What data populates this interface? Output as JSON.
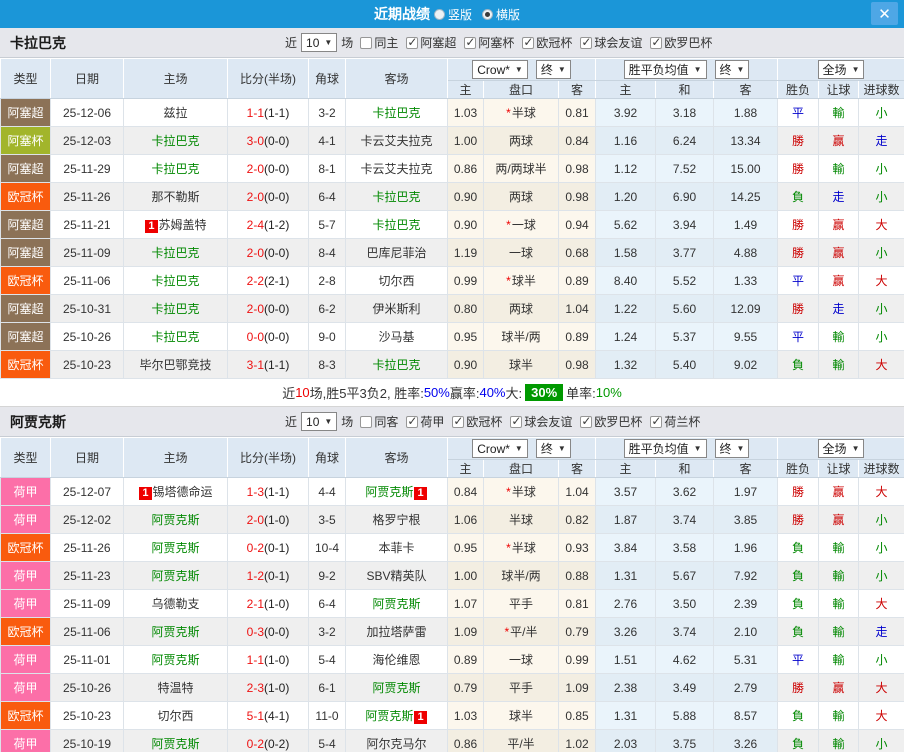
{
  "titlebar": {
    "title": "近期战绩",
    "radio_vertical": "竖版",
    "radio_horizontal": "横版",
    "close": "✕"
  },
  "columns": {
    "type": "类型",
    "date": "日期",
    "home": "主场",
    "score": "比分(半场)",
    "corner": "角球",
    "away": "客场",
    "group1_select": "Crow*",
    "group1_final": "终",
    "group2_select": "胜平负均值",
    "group2_final": "终",
    "group3_select": "全场",
    "sub": [
      "主",
      "盘口",
      "客",
      "主",
      "和",
      "客",
      "胜负",
      "让球",
      "进球数"
    ]
  },
  "type_colors": {
    "阿塞超": "#8c7257",
    "阿塞杯": "#a2b52b",
    "欧冠杯": "#f95b0e",
    "荷甲": "#fc6fa8"
  },
  "accent_colors": {
    "titlebar": "#1b96d8",
    "win": "#cc0000",
    "lose": "#008800",
    "draw": "#0000cc",
    "badge": "#ee0000"
  },
  "sections": [
    {
      "team": "卡拉巴克",
      "controls": {
        "near": "近",
        "count": "10",
        "games": "场",
        "same_label": "同主",
        "same_checked": false,
        "leagues": [
          "阿塞超",
          "阿塞杯",
          "欧冠杯",
          "球会友谊",
          "欧罗巴杯"
        ]
      },
      "rows": [
        {
          "t": "阿塞超",
          "d": "25-12-06",
          "h": "兹拉",
          "hg": 0,
          "hb": 0,
          "ft": "1-1",
          "ht": "(1-1)",
          "c": "3-2",
          "a": "卡拉巴克",
          "ag": 1,
          "ab": 0,
          "o1": "1.03",
          "st": 1,
          "hc": "半球",
          "o2": "0.81",
          "e1": "3.92",
          "e2": "3.18",
          "e3": "1.88",
          "r1": "平",
          "k1": "blue",
          "r2": "輸",
          "k2": "green",
          "r3": "小",
          "k3": "green"
        },
        {
          "t": "阿塞杯",
          "d": "25-12-03",
          "h": "卡拉巴克",
          "hg": 1,
          "hb": 0,
          "ft": "3-0",
          "ht": "(0-0)",
          "c": "4-1",
          "a": "卡云艾夫拉克",
          "ag": 0,
          "ab": 0,
          "o1": "1.00",
          "st": 0,
          "hc": "两球",
          "o2": "0.84",
          "e1": "1.16",
          "e2": "6.24",
          "e3": "13.34",
          "r1": "勝",
          "k1": "red",
          "r2": "赢",
          "k2": "red",
          "r3": "走",
          "k3": "blue"
        },
        {
          "t": "阿塞超",
          "d": "25-11-29",
          "h": "卡拉巴克",
          "hg": 1,
          "hb": 0,
          "ft": "2-0",
          "ht": "(0-0)",
          "c": "8-1",
          "a": "卡云艾夫拉克",
          "ag": 0,
          "ab": 0,
          "o1": "0.86",
          "st": 0,
          "hc": "两/两球半",
          "o2": "0.98",
          "e1": "1.12",
          "e2": "7.52",
          "e3": "15.00",
          "r1": "勝",
          "k1": "red",
          "r2": "輸",
          "k2": "green",
          "r3": "小",
          "k3": "green"
        },
        {
          "t": "欧冠杯",
          "d": "25-11-26",
          "h": "那不勒斯",
          "hg": 0,
          "hb": 0,
          "ft": "2-0",
          "ht": "(0-0)",
          "c": "6-4",
          "a": "卡拉巴克",
          "ag": 1,
          "ab": 0,
          "o1": "0.90",
          "st": 0,
          "hc": "两球",
          "o2": "0.98",
          "e1": "1.20",
          "e2": "6.90",
          "e3": "14.25",
          "r1": "負",
          "k1": "green",
          "r2": "走",
          "k2": "blue",
          "r3": "小",
          "k3": "green"
        },
        {
          "t": "阿塞超",
          "d": "25-11-21",
          "h": "苏姆盖特",
          "hg": 0,
          "hb": 1,
          "ft": "2-4",
          "ht": "(1-2)",
          "c": "5-7",
          "a": "卡拉巴克",
          "ag": 1,
          "ab": 0,
          "o1": "0.90",
          "st": 1,
          "hc": "一球",
          "o2": "0.94",
          "e1": "5.62",
          "e2": "3.94",
          "e3": "1.49",
          "r1": "勝",
          "k1": "red",
          "r2": "赢",
          "k2": "red",
          "r3": "大",
          "k3": "red"
        },
        {
          "t": "阿塞超",
          "d": "25-11-09",
          "h": "卡拉巴克",
          "hg": 1,
          "hb": 0,
          "ft": "2-0",
          "ht": "(0-0)",
          "c": "8-4",
          "a": "巴库尼菲治",
          "ag": 0,
          "ab": 0,
          "o1": "1.19",
          "st": 0,
          "hc": "一球",
          "o2": "0.68",
          "e1": "1.58",
          "e2": "3.77",
          "e3": "4.88",
          "r1": "勝",
          "k1": "red",
          "r2": "赢",
          "k2": "red",
          "r3": "小",
          "k3": "green"
        },
        {
          "t": "欧冠杯",
          "d": "25-11-06",
          "h": "卡拉巴克",
          "hg": 1,
          "hb": 0,
          "ft": "2-2",
          "ht": "(2-1)",
          "c": "2-8",
          "a": "切尔西",
          "ag": 0,
          "ab": 0,
          "o1": "0.99",
          "st": 1,
          "hc": "球半",
          "o2": "0.89",
          "e1": "8.40",
          "e2": "5.52",
          "e3": "1.33",
          "r1": "平",
          "k1": "blue",
          "r2": "赢",
          "k2": "red",
          "r3": "大",
          "k3": "red"
        },
        {
          "t": "阿塞超",
          "d": "25-10-31",
          "h": "卡拉巴克",
          "hg": 1,
          "hb": 0,
          "ft": "2-0",
          "ht": "(0-0)",
          "c": "6-2",
          "a": "伊米斯利",
          "ag": 0,
          "ab": 0,
          "o1": "0.80",
          "st": 0,
          "hc": "两球",
          "o2": "1.04",
          "e1": "1.22",
          "e2": "5.60",
          "e3": "12.09",
          "r1": "勝",
          "k1": "red",
          "r2": "走",
          "k2": "blue",
          "r3": "小",
          "k3": "green"
        },
        {
          "t": "阿塞超",
          "d": "25-10-26",
          "h": "卡拉巴克",
          "hg": 1,
          "hb": 0,
          "ft": "0-0",
          "ht": "(0-0)",
          "c": "9-0",
          "a": "沙马基",
          "ag": 0,
          "ab": 0,
          "o1": "0.95",
          "st": 0,
          "hc": "球半/两",
          "o2": "0.89",
          "e1": "1.24",
          "e2": "5.37",
          "e3": "9.55",
          "r1": "平",
          "k1": "blue",
          "r2": "輸",
          "k2": "green",
          "r3": "小",
          "k3": "green"
        },
        {
          "t": "欧冠杯",
          "d": "25-10-23",
          "h": "毕尔巴鄂竞技",
          "hg": 0,
          "hb": 0,
          "ft": "3-1",
          "ht": "(1-1)",
          "c": "8-3",
          "a": "卡拉巴克",
          "ag": 1,
          "ab": 0,
          "o1": "0.90",
          "st": 0,
          "hc": "球半",
          "o2": "0.98",
          "e1": "1.32",
          "e2": "5.40",
          "e3": "9.02",
          "r1": "負",
          "k1": "green",
          "r2": "輸",
          "k2": "green",
          "r3": "大",
          "k3": "red"
        }
      ],
      "summary": [
        {
          "t": "近",
          "s": "plain"
        },
        {
          "t": "10",
          "s": "red"
        },
        {
          "t": "场,胜5平3负2, 胜率:",
          "s": "plain"
        },
        {
          "t": "50%",
          "s": "blue"
        },
        {
          "t": " 赢率:",
          "s": "plain"
        },
        {
          "t": "40%",
          "s": "blue"
        },
        {
          "t": " 大:",
          "s": "plain"
        },
        {
          "t": "30%",
          "s": "greenbadge"
        },
        {
          "t": " 单率:",
          "s": "plain"
        },
        {
          "t": "10%",
          "s": "green"
        }
      ]
    },
    {
      "team": "阿贾克斯",
      "controls": {
        "near": "近",
        "count": "10",
        "games": "场",
        "same_label": "同客",
        "same_checked": false,
        "leagues": [
          "荷甲",
          "欧冠杯",
          "球会友谊",
          "欧罗巴杯",
          "荷兰杯"
        ]
      },
      "rows": [
        {
          "t": "荷甲",
          "d": "25-12-07",
          "h": "锡塔德命运",
          "hg": 0,
          "hb": 1,
          "ft": "1-3",
          "ht": "(1-1)",
          "c": "4-4",
          "a": "阿贾克斯",
          "ag": 1,
          "ab": 1,
          "o1": "0.84",
          "st": 1,
          "hc": "半球",
          "o2": "1.04",
          "e1": "3.57",
          "e2": "3.62",
          "e3": "1.97",
          "r1": "勝",
          "k1": "red",
          "r2": "赢",
          "k2": "red",
          "r3": "大",
          "k3": "red"
        },
        {
          "t": "荷甲",
          "d": "25-12-02",
          "h": "阿贾克斯",
          "hg": 1,
          "hb": 0,
          "ft": "2-0",
          "ht": "(1-0)",
          "c": "3-5",
          "a": "格罗宁根",
          "ag": 0,
          "ab": 0,
          "o1": "1.06",
          "st": 0,
          "hc": "半球",
          "o2": "0.82",
          "e1": "1.87",
          "e2": "3.74",
          "e3": "3.85",
          "r1": "勝",
          "k1": "red",
          "r2": "赢",
          "k2": "red",
          "r3": "小",
          "k3": "green"
        },
        {
          "t": "欧冠杯",
          "d": "25-11-26",
          "h": "阿贾克斯",
          "hg": 1,
          "hb": 0,
          "ft": "0-2",
          "ht": "(0-1)",
          "c": "10-4",
          "a": "本菲卡",
          "ag": 0,
          "ab": 0,
          "o1": "0.95",
          "st": 1,
          "hc": "半球",
          "o2": "0.93",
          "e1": "3.84",
          "e2": "3.58",
          "e3": "1.96",
          "r1": "負",
          "k1": "green",
          "r2": "輸",
          "k2": "green",
          "r3": "小",
          "k3": "green"
        },
        {
          "t": "荷甲",
          "d": "25-11-23",
          "h": "阿贾克斯",
          "hg": 1,
          "hb": 0,
          "ft": "1-2",
          "ht": "(0-1)",
          "c": "9-2",
          "a": "SBV精英队",
          "ag": 0,
          "ab": 0,
          "o1": "1.00",
          "st": 0,
          "hc": "球半/两",
          "o2": "0.88",
          "e1": "1.31",
          "e2": "5.67",
          "e3": "7.92",
          "r1": "負",
          "k1": "green",
          "r2": "輸",
          "k2": "green",
          "r3": "小",
          "k3": "green"
        },
        {
          "t": "荷甲",
          "d": "25-11-09",
          "h": "乌德勒支",
          "hg": 0,
          "hb": 0,
          "ft": "2-1",
          "ht": "(1-0)",
          "c": "6-4",
          "a": "阿贾克斯",
          "ag": 1,
          "ab": 0,
          "o1": "1.07",
          "st": 0,
          "hc": "平手",
          "o2": "0.81",
          "e1": "2.76",
          "e2": "3.50",
          "e3": "2.39",
          "r1": "負",
          "k1": "green",
          "r2": "輸",
          "k2": "green",
          "r3": "大",
          "k3": "red"
        },
        {
          "t": "欧冠杯",
          "d": "25-11-06",
          "h": "阿贾克斯",
          "hg": 1,
          "hb": 0,
          "ft": "0-3",
          "ht": "(0-0)",
          "c": "3-2",
          "a": "加拉塔萨雷",
          "ag": 0,
          "ab": 0,
          "o1": "1.09",
          "st": 1,
          "hc": "平/半",
          "o2": "0.79",
          "e1": "3.26",
          "e2": "3.74",
          "e3": "2.10",
          "r1": "負",
          "k1": "green",
          "r2": "輸",
          "k2": "green",
          "r3": "走",
          "k3": "blue"
        },
        {
          "t": "荷甲",
          "d": "25-11-01",
          "h": "阿贾克斯",
          "hg": 1,
          "hb": 0,
          "ft": "1-1",
          "ht": "(1-0)",
          "c": "5-4",
          "a": "海伦维恩",
          "ag": 0,
          "ab": 0,
          "o1": "0.89",
          "st": 0,
          "hc": "一球",
          "o2": "0.99",
          "e1": "1.51",
          "e2": "4.62",
          "e3": "5.31",
          "r1": "平",
          "k1": "blue",
          "r2": "輸",
          "k2": "green",
          "r3": "小",
          "k3": "green"
        },
        {
          "t": "荷甲",
          "d": "25-10-26",
          "h": "特温特",
          "hg": 0,
          "hb": 0,
          "ft": "2-3",
          "ht": "(1-0)",
          "c": "6-1",
          "a": "阿贾克斯",
          "ag": 1,
          "ab": 0,
          "o1": "0.79",
          "st": 0,
          "hc": "平手",
          "o2": "1.09",
          "e1": "2.38",
          "e2": "3.49",
          "e3": "2.79",
          "r1": "勝",
          "k1": "red",
          "r2": "赢",
          "k2": "red",
          "r3": "大",
          "k3": "red"
        },
        {
          "t": "欧冠杯",
          "d": "25-10-23",
          "h": "切尔西",
          "hg": 0,
          "hb": 0,
          "ft": "5-1",
          "ht": "(4-1)",
          "c": "11-0",
          "a": "阿贾克斯",
          "ag": 1,
          "ab": 1,
          "o1": "1.03",
          "st": 0,
          "hc": "球半",
          "o2": "0.85",
          "e1": "1.31",
          "e2": "5.88",
          "e3": "8.57",
          "r1": "負",
          "k1": "green",
          "r2": "輸",
          "k2": "green",
          "r3": "大",
          "k3": "red"
        },
        {
          "t": "荷甲",
          "d": "25-10-19",
          "h": "阿贾克斯",
          "hg": 1,
          "hb": 0,
          "ft": "0-2",
          "ht": "(0-2)",
          "c": "5-4",
          "a": "阿尔克马尔",
          "ag": 0,
          "ab": 0,
          "o1": "0.86",
          "st": 0,
          "hc": "平/半",
          "o2": "1.02",
          "e1": "2.03",
          "e2": "3.75",
          "e3": "3.26",
          "r1": "負",
          "k1": "green",
          "r2": "輸",
          "k2": "green",
          "r3": "小",
          "k3": "green"
        }
      ],
      "summary": null
    }
  ]
}
